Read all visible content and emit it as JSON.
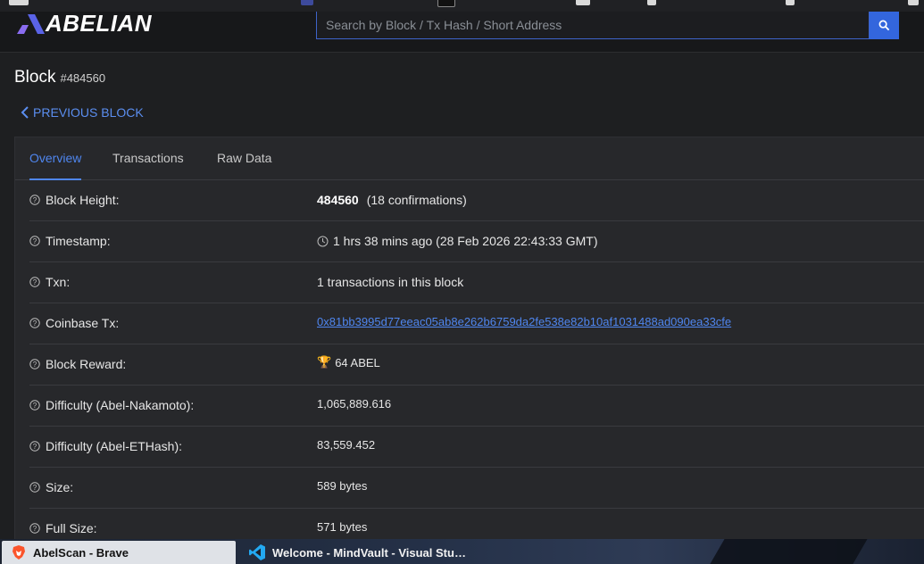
{
  "header": {
    "logo_text": "ABELIAN",
    "search_placeholder": "Search by Block / Tx Hash / Short Address"
  },
  "page": {
    "title": "Block",
    "block_number": "#484560",
    "previous_label": "PREVIOUS BLOCK"
  },
  "tabs": [
    {
      "label": "Overview"
    },
    {
      "label": "Transactions"
    },
    {
      "label": "Raw Data"
    }
  ],
  "details": {
    "block_height": {
      "label": "Block Height:",
      "value": "484560",
      "extra": "(18 confirmations)"
    },
    "timestamp": {
      "label": "Timestamp:",
      "value": "1 hrs 38 mins ago (28 Feb 2026 22:43:33 GMT)"
    },
    "txn": {
      "label": "Txn:",
      "value": "1 transactions in this block"
    },
    "coinbase_tx": {
      "label": "Coinbase Tx:",
      "value": "0x81bb3995d77eeac05ab8e262b6759da2fe538e82b10af1031488ad090ea33cfe"
    },
    "block_reward": {
      "label": "Block Reward:",
      "icon": "🏆",
      "value": "64 ABEL"
    },
    "difficulty_nakamoto": {
      "label": "Difficulty (Abel-Nakamoto):",
      "value": "1,065,889.616"
    },
    "difficulty_ethash": {
      "label": "Difficulty (Abel-ETHash):",
      "value": "83,559.452"
    },
    "size": {
      "label": "Size:",
      "value": "589 bytes"
    },
    "full_size": {
      "label": "Full Size:",
      "value": "571 bytes"
    }
  },
  "taskbar": {
    "items": [
      {
        "label": "AbelScan - Brave"
      },
      {
        "label": "Welcome - MindVault - Visual Stu…"
      }
    ]
  },
  "colors": {
    "accent": "#4f86ef",
    "search_button": "#3366dd",
    "background": "#1e1f21",
    "card": "#27282b"
  }
}
